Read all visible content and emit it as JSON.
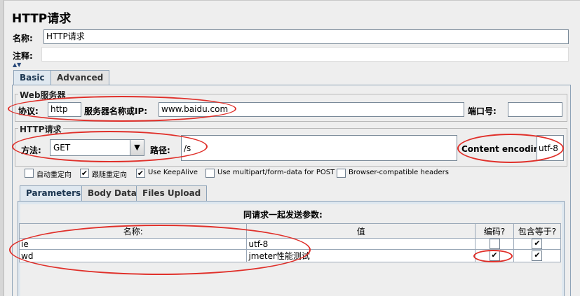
{
  "header": {
    "title": "HTTP请求"
  },
  "name_field": {
    "label": "名称:",
    "value": "HTTP请求"
  },
  "comment_field": {
    "label": "注释:",
    "value": ""
  },
  "main_tabs": [
    {
      "label": "Basic"
    },
    {
      "label": "Advanced"
    }
  ],
  "web_server": {
    "title": "Web服务器",
    "protocol_label": "协议:",
    "protocol_value": "http",
    "server_label": "服务器名称或IP:",
    "server_value": "www.baidu.com",
    "port_label": "端口号:",
    "port_value": ""
  },
  "http_request": {
    "title": "HTTP请求",
    "method_label": "方法:",
    "method_value": "GET",
    "path_label": "路径:",
    "path_value": "/s",
    "encoding_label": "Content encoding:",
    "encoding_value": "utf-8"
  },
  "options": [
    {
      "label": "自动重定向",
      "checked": false
    },
    {
      "label": "跟随重定向",
      "checked": true
    },
    {
      "label": "Use KeepAlive",
      "checked": true
    },
    {
      "label": "Use multipart/form-data for POST",
      "checked": false
    },
    {
      "label": "Browser-compatible headers",
      "checked": false
    }
  ],
  "sub_tabs": [
    {
      "label": "Parameters"
    },
    {
      "label": "Body Data"
    },
    {
      "label": "Files Upload"
    }
  ],
  "params": {
    "caption": "同请求一起发送参数:",
    "headers": [
      "名称:",
      "值",
      "编码?",
      "包含等于?"
    ],
    "rows": [
      {
        "name": "ie",
        "value": "utf-8",
        "encode": false,
        "include_equals": true
      },
      {
        "name": "wd",
        "value": "jmeter性能测试",
        "encode": true,
        "include_equals": true
      }
    ]
  },
  "glyphs": {
    "check": "✔",
    "arrow": "▼"
  },
  "colors": {
    "annotation": "#e0302a",
    "tab_selected": "#dfe8f0",
    "border": "#8ea3b8"
  }
}
